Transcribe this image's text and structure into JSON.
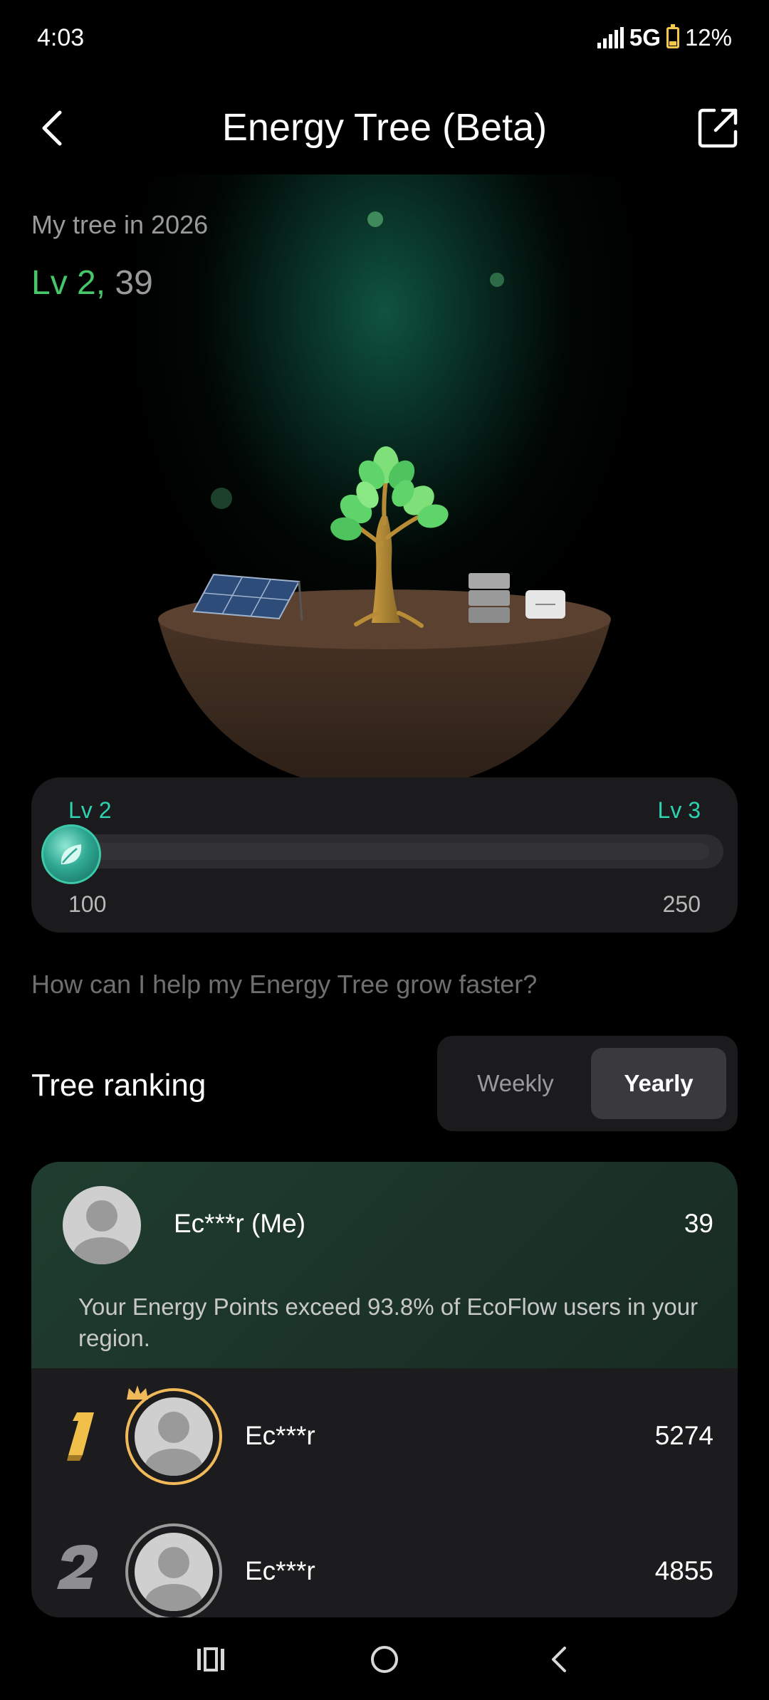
{
  "status_bar": {
    "time": "4:03",
    "network": "5G",
    "battery": "12%"
  },
  "header": {
    "title": "Energy Tree (Beta)",
    "back_icon": "chevron-left-icon",
    "share_icon": "external-share-icon"
  },
  "tree": {
    "year_label": "My tree in 2026",
    "level_label": "Lv 2,",
    "points": "39"
  },
  "progress": {
    "current_level": "Lv 2",
    "next_level": "Lv 3",
    "min_value": "100",
    "max_value": "250",
    "fill_fraction": 0.0,
    "accent_color": "#2ed1b0"
  },
  "help_text": "How can I help my Energy Tree grow faster?",
  "ranking": {
    "title": "Tree ranking",
    "tabs": [
      {
        "label": "Weekly",
        "selected": false
      },
      {
        "label": "Yearly",
        "selected": true
      }
    ],
    "me": {
      "name": "Ec***r (Me)",
      "points": "39",
      "note": "Your Energy Points exceed 93.8% of EcoFlow users in your region."
    },
    "rows": [
      {
        "rank": "1",
        "name": "Ec***r",
        "points": "5274",
        "ring_color": "#f0b95a"
      },
      {
        "rank": "2",
        "name": "Ec***r",
        "points": "4855",
        "ring_color": "#9a9a9a"
      }
    ]
  },
  "nav": {
    "recents_icon": "recents-icon",
    "home_icon": "home-icon",
    "back_icon": "nav-back-icon"
  }
}
